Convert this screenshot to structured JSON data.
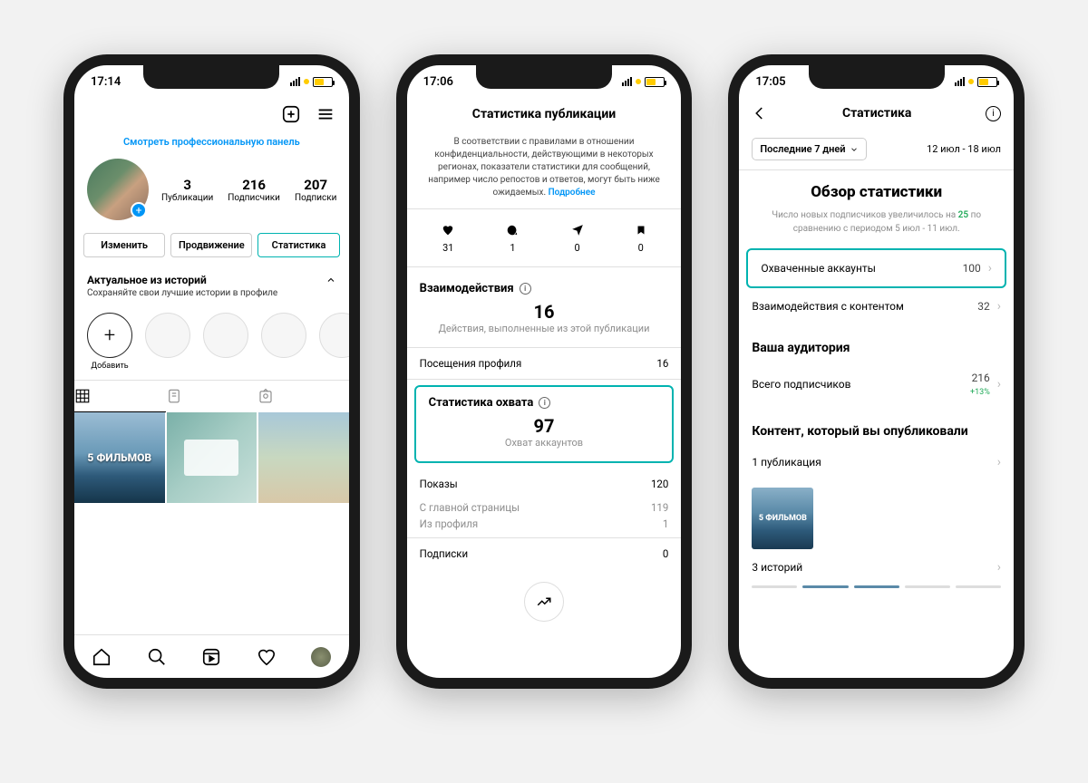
{
  "phone1": {
    "time": "17:14",
    "pro_panel_link": "Смотреть профессиональную панель",
    "stats": {
      "posts": {
        "value": "3",
        "label": "Публикации"
      },
      "followers": {
        "value": "216",
        "label": "Подписчики"
      },
      "following": {
        "value": "207",
        "label": "Подписки"
      }
    },
    "tabs": {
      "edit": "Изменить",
      "promote": "Продвижение",
      "stats": "Статистика"
    },
    "highlights": {
      "title": "Актуальное из историй",
      "subtitle": "Сохраняйте свои лучшие истории в профиле",
      "add_label": "Добавить"
    },
    "grid_overlay_1": "5 ФИЛЬМОВ"
  },
  "phone2": {
    "time": "17:06",
    "title": "Статистика публикации",
    "privacy_note": "В соответствии с правилами в отношении конфиденциальности, действующими в некоторых регионах, показатели статистики для сообщений, например число репостов и ответов, могут быть ниже ожидаемых.",
    "privacy_more": "Подробнее",
    "icons": {
      "likes": "31",
      "comments": "1",
      "shares": "0",
      "saves": "0"
    },
    "interactions_title": "Взаимодействия",
    "interactions_value": "16",
    "interactions_sub": "Действия, выполненные из этой публикации",
    "profile_visits_label": "Посещения профиля",
    "profile_visits_value": "16",
    "reach_title": "Статистика охвата",
    "reach_value": "97",
    "reach_sub": "Охват аккаунтов",
    "impressions_label": "Показы",
    "impressions_value": "120",
    "from_home_label": "С главной страницы",
    "from_home_value": "119",
    "from_profile_label": "Из профиля",
    "from_profile_value": "1",
    "follows_label": "Подписки",
    "follows_value": "0"
  },
  "phone3": {
    "time": "17:05",
    "nav_title": "Статистика",
    "period_chip": "Последние 7 дней",
    "period_range": "12 июл - 18 июл",
    "overview_title": "Обзор статистики",
    "overview_note_pre": "Число новых подписчиков увеличилось на ",
    "overview_delta": "25",
    "overview_note_post": " по сравнению с периодом 5 июл - 11 июл.",
    "reached_accounts_label": "Охваченные аккаунты",
    "reached_accounts_value": "100",
    "content_interactions_label": "Взаимодействия с контентом",
    "content_interactions_value": "32",
    "audience_title": "Ваша аудитория",
    "total_followers_label": "Всего подписчиков",
    "total_followers_value": "216",
    "total_followers_delta": "+13%",
    "content_title": "Контент, который вы опубликовали",
    "posts_count_label": "1 публикация",
    "thumb_text": "5 ФИЛЬМОВ",
    "stories_count_label": "3 историй"
  }
}
